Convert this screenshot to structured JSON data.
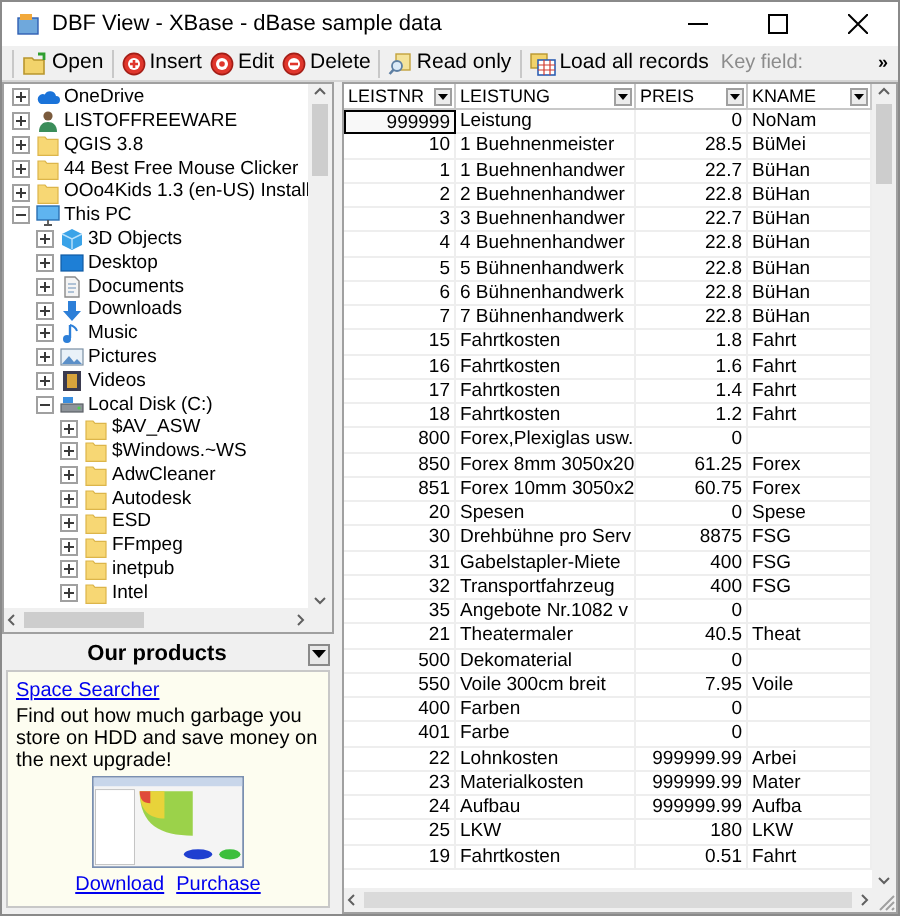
{
  "window": {
    "title": "DBF View - XBase - dBase sample data"
  },
  "toolbar": {
    "buttons": [
      {
        "label": "Open",
        "kind": "open"
      },
      {
        "label": "Insert",
        "kind": "insert"
      },
      {
        "label": "Edit",
        "kind": "edit"
      },
      {
        "label": "Delete",
        "kind": "delete"
      },
      {
        "label": "Read only",
        "kind": "readonly"
      },
      {
        "label": "Load all records",
        "kind": "loadall"
      }
    ],
    "key_field_label": "Key field:",
    "overflow": "»"
  },
  "tree": [
    {
      "label": "OneDrive",
      "kind": "cloud",
      "expanded": false
    },
    {
      "label": "LISTOFFREEWARE",
      "kind": "user",
      "expanded": false
    },
    {
      "label": "QGIS 3.8",
      "kind": "folder",
      "expanded": false
    },
    {
      "label": "44 Best Free Mouse Clicker",
      "kind": "folder",
      "expanded": false
    },
    {
      "label": "OOo4Kids 1.3 (en-US) Install",
      "kind": "folder",
      "expanded": false
    },
    {
      "label": "This PC",
      "kind": "pc",
      "expanded": true,
      "children": [
        {
          "label": "3D Objects",
          "kind": "cube",
          "expanded": false
        },
        {
          "label": "Desktop",
          "kind": "desktop",
          "expanded": false
        },
        {
          "label": "Documents",
          "kind": "documents",
          "expanded": false
        },
        {
          "label": "Downloads",
          "kind": "downloads",
          "expanded": false
        },
        {
          "label": "Music",
          "kind": "music",
          "expanded": false
        },
        {
          "label": "Pictures",
          "kind": "pictures",
          "expanded": false
        },
        {
          "label": "Videos",
          "kind": "videos",
          "expanded": false
        },
        {
          "label": "Local Disk (C:)",
          "kind": "disk",
          "expanded": true,
          "children": [
            {
              "label": "$AV_ASW",
              "kind": "folder",
              "expanded": false
            },
            {
              "label": "$Windows.~WS",
              "kind": "folder",
              "expanded": false
            },
            {
              "label": "AdwCleaner",
              "kind": "folder",
              "expanded": false
            },
            {
              "label": "Autodesk",
              "kind": "folder",
              "expanded": false
            },
            {
              "label": "ESD",
              "kind": "folder",
              "expanded": false
            },
            {
              "label": "FFmpeg",
              "kind": "folder",
              "expanded": false
            },
            {
              "label": "inetpub",
              "kind": "folder",
              "expanded": false
            },
            {
              "label": "Intel",
              "kind": "folder",
              "expanded": false
            }
          ]
        }
      ]
    }
  ],
  "products": {
    "title": "Our products",
    "product_link": "Space Searcher",
    "description": "Find out how much garbage you store on HDD and save money on the next upgrade!",
    "links": [
      "Download",
      "Purchase"
    ]
  },
  "table": {
    "columns": [
      "LEISTNR",
      "LEISTUNG",
      "PREIS",
      "KNAME"
    ],
    "rows": [
      {
        "leistnr": "999999",
        "leistung": "Leistung",
        "preis": "0",
        "kname": "NoNam",
        "selected": true
      },
      {
        "leistnr": "10",
        "leistung": "1 Buehnenmeister",
        "preis": "28.5",
        "kname": "BüMei",
        "selected": false
      },
      {
        "leistnr": "1",
        "leistung": "1 Buehnenhandwer",
        "preis": "22.7",
        "kname": "BüHan",
        "selected": false
      },
      {
        "leistnr": "2",
        "leistung": "2 Buehnenhandwer",
        "preis": "22.8",
        "kname": "BüHan",
        "selected": false
      },
      {
        "leistnr": "3",
        "leistung": "3 Buehnenhandwer",
        "preis": "22.7",
        "kname": "BüHan",
        "selected": false
      },
      {
        "leistnr": "4",
        "leistung": "4 Buehnenhandwer",
        "preis": "22.8",
        "kname": "BüHan",
        "selected": false
      },
      {
        "leistnr": "5",
        "leistung": "5 Bühnenhandwerk",
        "preis": "22.8",
        "kname": "BüHan",
        "selected": false
      },
      {
        "leistnr": "6",
        "leistung": "6 Bühnenhandwerk",
        "preis": "22.8",
        "kname": "BüHan",
        "selected": false
      },
      {
        "leistnr": "7",
        "leistung": "7 Bühnenhandwerk",
        "preis": "22.8",
        "kname": "BüHan",
        "selected": false
      },
      {
        "leistnr": "15",
        "leistung": "Fahrtkosten",
        "preis": "1.8",
        "kname": "Fahrt",
        "selected": false
      },
      {
        "leistnr": "16",
        "leistung": "Fahrtkosten",
        "preis": "1.6",
        "kname": "Fahrt",
        "selected": false
      },
      {
        "leistnr": "17",
        "leistung": "Fahrtkosten",
        "preis": "1.4",
        "kname": "Fahrt",
        "selected": false
      },
      {
        "leistnr": "18",
        "leistung": "Fahrtkosten",
        "preis": "1.2",
        "kname": "Fahrt",
        "selected": false
      },
      {
        "leistnr": "800",
        "leistung": "Forex,Plexiglas usw.",
        "preis": "0",
        "selected": false
      },
      {
        "leistnr": "850",
        "leistung": "Forex 8mm 3050x20",
        "preis": "61.25",
        "kname": "Forex",
        "selected": false
      },
      {
        "leistnr": "851",
        "leistung": "Forex 10mm 3050x2",
        "preis": "60.75",
        "kname": "Forex",
        "selected": false
      },
      {
        "leistnr": "20",
        "leistung": "Spesen",
        "preis": "0",
        "kname": "Spese",
        "selected": false
      },
      {
        "leistnr": "30",
        "leistung": "Drehbühne pro Serv",
        "preis": "8875",
        "kname": "FSG",
        "selected": false
      },
      {
        "leistnr": "31",
        "leistung": "Gabelstapler-Miete",
        "preis": "400",
        "kname": "FSG",
        "selected": false
      },
      {
        "leistnr": "32",
        "leistung": "Transportfahrzeug",
        "preis": "400",
        "kname": "FSG",
        "selected": false
      },
      {
        "leistnr": "35",
        "leistung": "Angebote Nr.1082 v",
        "preis": "0",
        "selected": false
      },
      {
        "leistnr": "21",
        "leistung": "Theatermaler",
        "preis": "40.5",
        "kname": "Theat",
        "selected": false
      },
      {
        "leistnr": "500",
        "leistung": "Dekomaterial",
        "preis": "0",
        "selected": false
      },
      {
        "leistnr": "550",
        "leistung": "Voile 300cm breit",
        "preis": "7.95",
        "kname": "Voile",
        "selected": false
      },
      {
        "leistnr": "400",
        "leistung": "Farben",
        "preis": "0",
        "selected": false
      },
      {
        "leistnr": "401",
        "leistung": "Farbe",
        "preis": "0",
        "selected": false
      },
      {
        "leistnr": "22",
        "leistung": "Lohnkosten",
        "preis": "999999.99",
        "kname": "Arbei",
        "selected": false
      },
      {
        "leistnr": "23",
        "leistung": "Materialkosten",
        "preis": "999999.99",
        "kname": "Mater",
        "selected": false
      },
      {
        "leistnr": "24",
        "leistung": "Aufbau",
        "preis": "999999.99",
        "kname": "Aufba",
        "selected": false
      },
      {
        "leistnr": "25",
        "leistung": "LKW",
        "preis": "180",
        "kname": "LKW",
        "selected": false
      },
      {
        "leistnr": "19",
        "leistung": "Fahrtkosten",
        "preis": "0.51",
        "kname": "Fahrt",
        "selected": false
      }
    ]
  }
}
